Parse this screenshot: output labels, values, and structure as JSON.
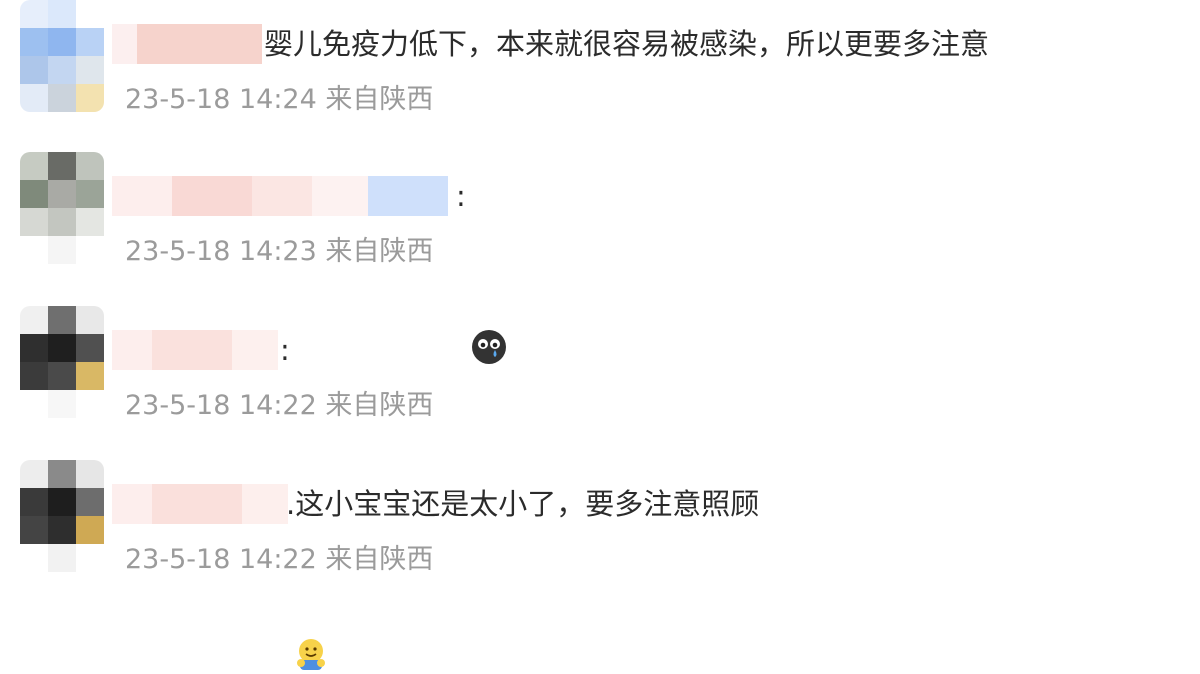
{
  "comments": [
    {
      "prefix": "",
      "text": "婴儿免疫力低下，本来就很容易被感染，所以更要多注意",
      "time": "23-5-18 14:24",
      "location": "来自陕西",
      "emoji": null
    },
    {
      "prefix": ":",
      "text": "",
      "time": "23-5-18 14:23",
      "location": "来自陕西",
      "emoji": "crying-face-icon"
    },
    {
      "prefix": ":",
      "text": "",
      "time": "23-5-18 14:22",
      "location": "来自陕西",
      "emoji": "hug-face-icon"
    },
    {
      "prefix": "",
      "text": ".这小宝宝还是太小了，要多注意照顾",
      "time": "23-5-18 14:22",
      "location": "来自陕西",
      "emoji": null
    }
  ]
}
